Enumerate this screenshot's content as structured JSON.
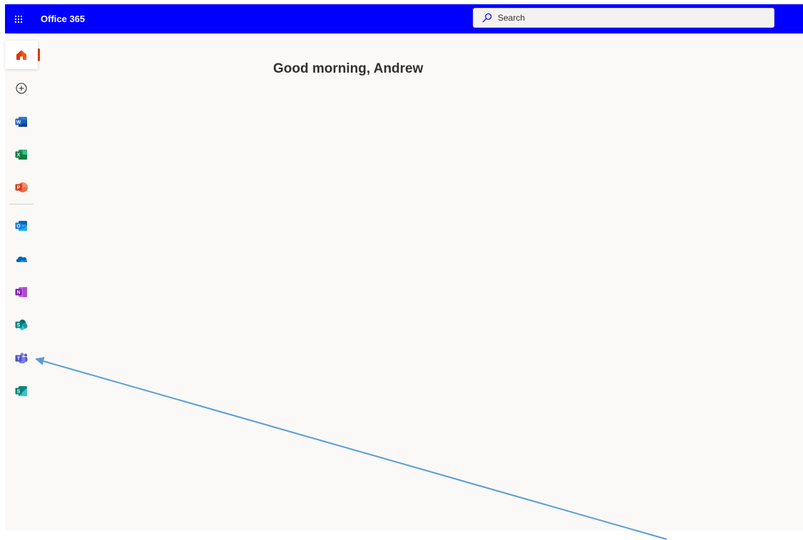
{
  "header": {
    "brand": "Office 365",
    "search_placeholder": "Search",
    "background_color": "#0000ff"
  },
  "rail": {
    "items": [
      {
        "name": "home",
        "icon": "home-icon",
        "active": true
      },
      {
        "name": "create",
        "icon": "plus-circle-icon"
      },
      {
        "name": "word",
        "icon": "word-icon"
      },
      {
        "name": "excel",
        "icon": "excel-icon"
      },
      {
        "name": "powerpoint",
        "icon": "powerpoint-icon"
      },
      {
        "name": "outlook",
        "icon": "outlook-icon"
      },
      {
        "name": "onedrive",
        "icon": "onedrive-icon"
      },
      {
        "name": "onenote",
        "icon": "onenote-icon"
      },
      {
        "name": "sharepoint",
        "icon": "sharepoint-icon"
      },
      {
        "name": "teams",
        "icon": "teams-icon"
      },
      {
        "name": "sway",
        "icon": "sway-icon"
      }
    ],
    "active_accent": "#d83b01"
  },
  "main": {
    "greeting": "Good morning, Andrew"
  },
  "annotation": {
    "arrow_color": "#5b9bd5",
    "points_to": "teams-icon"
  }
}
